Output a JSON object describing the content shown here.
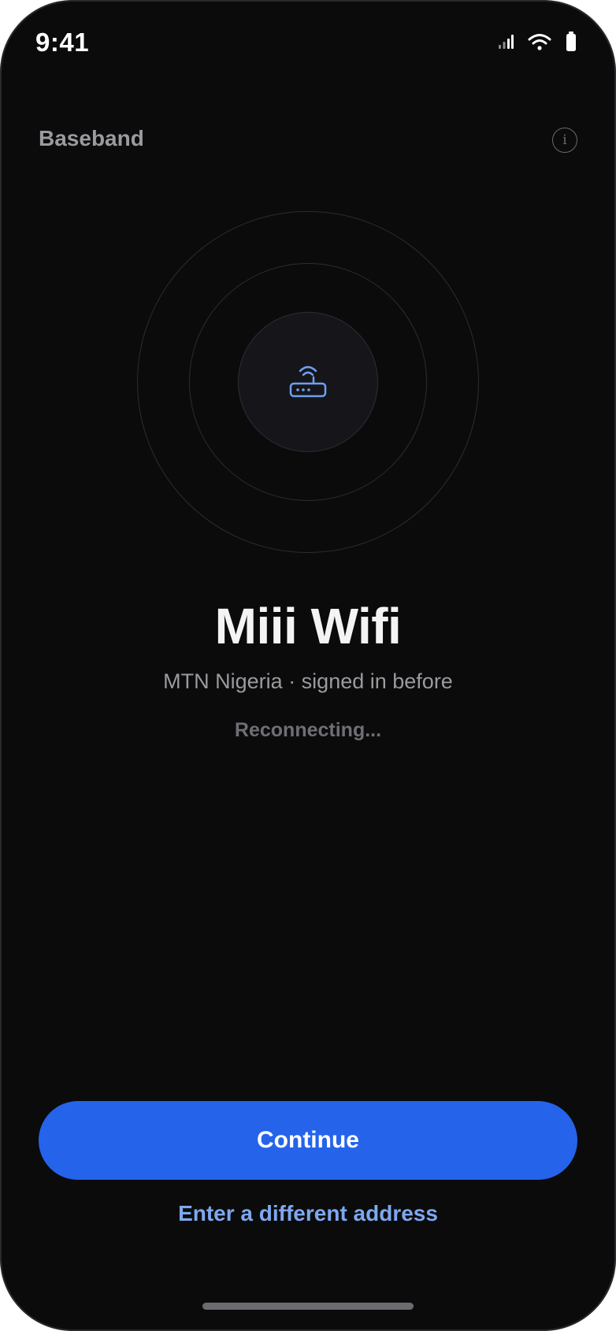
{
  "status_bar": {
    "time": "9:41",
    "icons": [
      "cellular-signal-icon",
      "wifi-icon",
      "battery-icon"
    ]
  },
  "header": {
    "brand": "Baseband",
    "info_icon": "info-icon",
    "info_glyph": "i"
  },
  "network": {
    "icon": "router-icon",
    "name": "Miii Wifi",
    "subtitle": "MTN Nigeria · signed in before",
    "status": "Reconnecting..."
  },
  "actions": {
    "continue_label": "Continue",
    "alt_label": "Enter a different address"
  },
  "colors": {
    "background": "#0b0b0c",
    "accent": "#2563eb",
    "link": "#7ea8ef",
    "router_icon": "#6f9ff0"
  }
}
